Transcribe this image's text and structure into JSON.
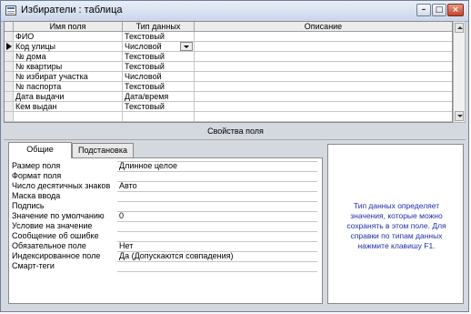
{
  "window": {
    "title": "Избиратели : таблица"
  },
  "grid": {
    "headers": {
      "field_name": "Имя поля",
      "data_type": "Тип данных",
      "description": "Описание"
    },
    "rows": [
      {
        "name": "ФИО",
        "type": "Текстовый",
        "desc": ""
      },
      {
        "name": "Код улицы",
        "type": "Числовой",
        "desc": ""
      },
      {
        "name": "№ дома",
        "type": "Текстовый",
        "desc": ""
      },
      {
        "name": "№ квартиры",
        "type": "Текстовый",
        "desc": ""
      },
      {
        "name": "№ избират участка",
        "type": "Числовой",
        "desc": ""
      },
      {
        "name": "№ паспорта",
        "type": "Текстовый",
        "desc": ""
      },
      {
        "name": "Дата выдачи",
        "type": "Дата/время",
        "desc": ""
      },
      {
        "name": "Кем выдан",
        "type": "Текстовый",
        "desc": ""
      }
    ]
  },
  "props": {
    "section_title": "Свойства поля",
    "tabs": {
      "general": "Общие",
      "lookup": "Подстановка"
    },
    "rows": [
      {
        "label": "Размер поля",
        "value": "Длинное целое"
      },
      {
        "label": "Формат поля",
        "value": ""
      },
      {
        "label": "Число десятичных знаков",
        "value": "Авто"
      },
      {
        "label": "Маска ввода",
        "value": ""
      },
      {
        "label": "Подпись",
        "value": ""
      },
      {
        "label": "Значение по умолчанию",
        "value": "0"
      },
      {
        "label": "Условие на значение",
        "value": ""
      },
      {
        "label": "Сообщение об ошибке",
        "value": ""
      },
      {
        "label": "Обязательное поле",
        "value": "Нет"
      },
      {
        "label": "Индексированное поле",
        "value": "Да (Допускаются совпадения)"
      },
      {
        "label": "Смарт-теги",
        "value": ""
      }
    ]
  },
  "help": {
    "text": "Тип данных определяет значения, которые можно сохранять в этом поле. Для справки по типам данных нажмите клавишу F1."
  }
}
